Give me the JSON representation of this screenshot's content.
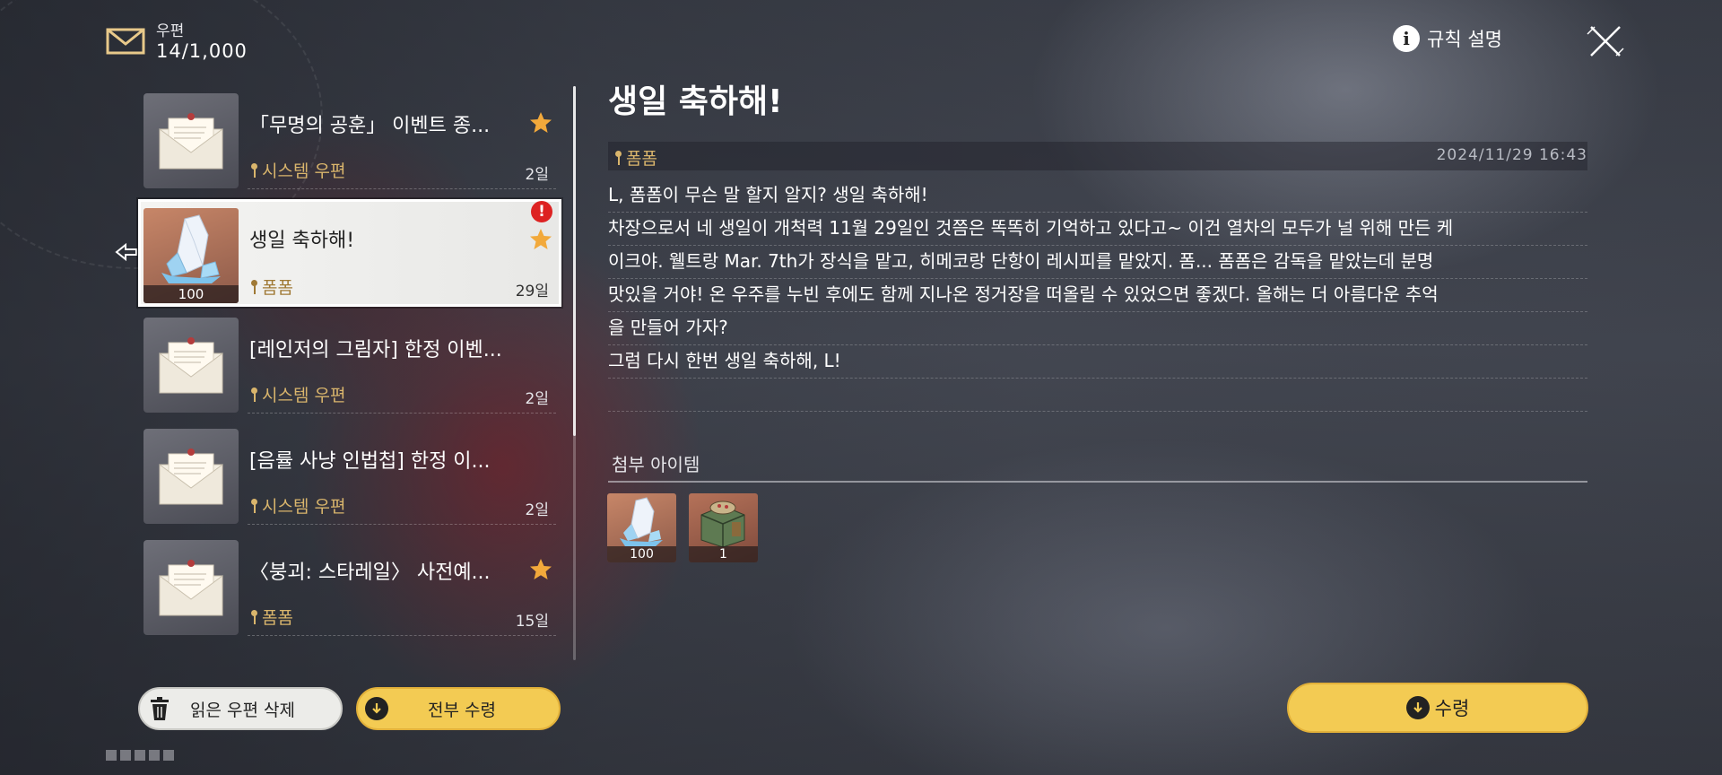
{
  "header": {
    "mail_label": "우편",
    "mail_count": "14/1,000",
    "rules_label": "규칙 설명"
  },
  "mail_list": [
    {
      "title": "「무명의 공훈」 이벤트 종...",
      "sender": "시스템 우편",
      "days": "2일",
      "starred": true
    },
    {
      "title": "생일 축하해!",
      "sender": "폼폼",
      "days": "29일",
      "starred": true,
      "selected": true,
      "thumb_qty": "100",
      "alert": "!"
    },
    {
      "title": "[레인저의 그림자] 한정 이벤...",
      "sender": "시스템 우편",
      "days": "2일",
      "starred": false
    },
    {
      "title": "[음률 사냥 인법첩] 한정 이...",
      "sender": "시스템 우편",
      "days": "2일",
      "starred": false
    },
    {
      "title": "〈붕괴: 스타레일〉 사전예...",
      "sender": "폼폼",
      "days": "15일",
      "starred": true
    }
  ],
  "buttons": {
    "delete_read": "읽은 우편 삭제",
    "claim_all": "전부 수령",
    "claim": "수령"
  },
  "detail": {
    "title": "생일 축하해!",
    "sender": "폼폼",
    "date": "2024/11/29 16:43",
    "body": [
      "L, 폼폼이 무슨 말 할지 알지? 생일 축하해!",
      "차장으로서 네 생일이 개척력 11월 29일인 것쯤은 똑똑히 기억하고 있다고~ 이건 열차의 모두가 널 위해 만든 케",
      "이크야. 웰트랑 Mar. 7th가 장식을 맡고, 히메코랑 단항이 레시피를 맡았지. 폼... 폼폼은 감독을 맡았는데 분명",
      "맛있을 거야! 온 우주를 누빈 후에도 함께 지나온 정거장을 떠올릴 수 있었으면 좋겠다. 올해는 더 아름다운 추억",
      "을 만들어 가자?",
      "그럼 다시 한번 생일 축하해, L!",
      ""
    ],
    "attachments_label": "첨부 아이템",
    "attachments": [
      {
        "icon": "crystal-icon",
        "qty": "100"
      },
      {
        "icon": "cake-box-icon",
        "qty": "1"
      }
    ]
  },
  "colors": {
    "accent_yellow": "#f3cb53",
    "sender_gold": "#d9b56c",
    "star_orange": "#f2a93b",
    "alert_red": "#dd2222"
  }
}
